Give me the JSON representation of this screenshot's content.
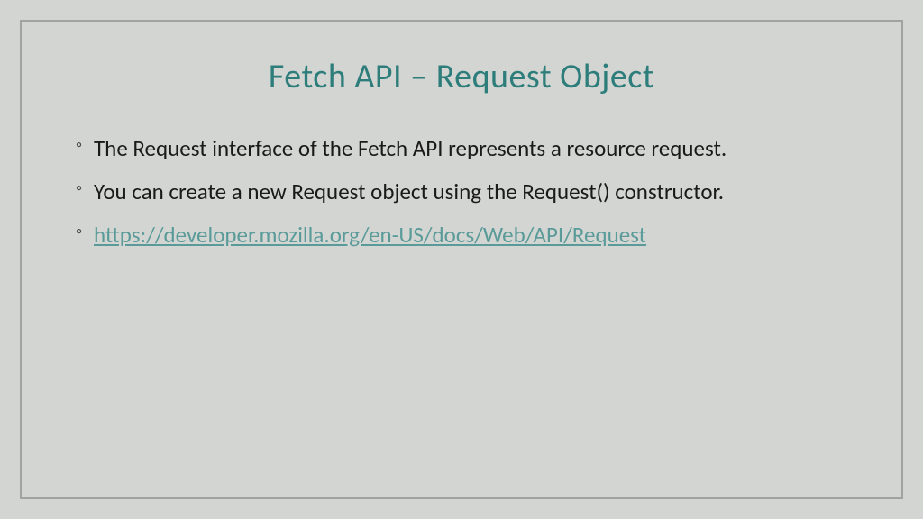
{
  "slide": {
    "title": "Fetch API – Request Object",
    "bullets": [
      {
        "text": "The Request interface of the Fetch API represents a resource request.",
        "isLink": false
      },
      {
        "text": "You can create a new Request object using the Request() constructor.",
        "isLink": false
      },
      {
        "text": "https://developer.mozilla.org/en-US/docs/Web/API/Request",
        "isLink": true
      }
    ]
  }
}
